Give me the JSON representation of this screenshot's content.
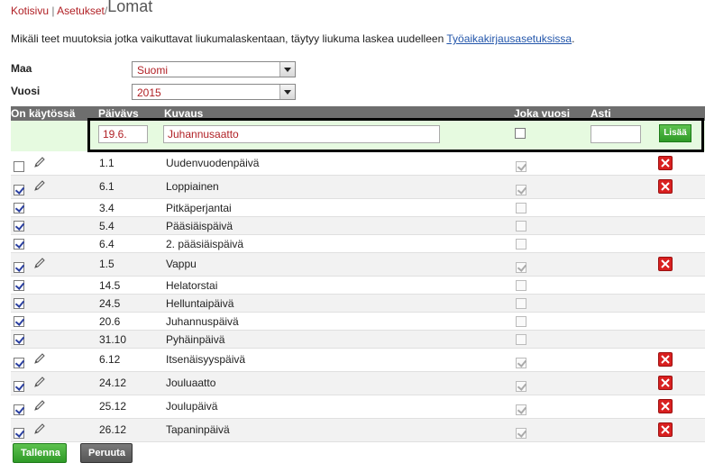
{
  "breadcrumb": {
    "home": "Kotisivu",
    "settings": "Asetukset",
    "current": "Lomat",
    "sep": "|",
    "sep2": "/"
  },
  "notice": {
    "text": "Mikäli teet muutoksia jotka vaikuttavat liukumalaskentaan, täytyy liukuma laskea uudelleen ",
    "link": "Työaikakirjausasetuksissa",
    "end": "."
  },
  "filters": {
    "country_label": "Maa",
    "country_value": "Suomi",
    "year_label": "Vuosi",
    "year_value": "2015"
  },
  "table": {
    "headers": {
      "enabled": "On käytössä",
      "date": "Päivävs",
      "desc": "Kuvaus",
      "yearly": "Joka vuosi",
      "until": "Asti"
    },
    "new_row": {
      "date": "19.6.",
      "desc": "Juhannusaatto",
      "until": "",
      "yearly": false,
      "add_label": "Lisää"
    },
    "rows": [
      {
        "enabled": false,
        "editable": true,
        "date": "1.1",
        "desc": "Uudenvuodenpäivä",
        "yearly": true,
        "deletable": true
      },
      {
        "enabled": true,
        "editable": true,
        "date": "6.1",
        "desc": "Loppiainen",
        "yearly": true,
        "deletable": true
      },
      {
        "enabled": true,
        "editable": false,
        "date": "3.4",
        "desc": "Pitkäperjantai",
        "yearly": false,
        "deletable": false
      },
      {
        "enabled": true,
        "editable": false,
        "date": "5.4",
        "desc": "Pääsiäispäivä",
        "yearly": false,
        "deletable": false
      },
      {
        "enabled": true,
        "editable": false,
        "date": "6.4",
        "desc": "2. pääsiäispäivä",
        "yearly": false,
        "deletable": false
      },
      {
        "enabled": true,
        "editable": true,
        "date": "1.5",
        "desc": "Vappu",
        "yearly": true,
        "deletable": true
      },
      {
        "enabled": true,
        "editable": false,
        "date": "14.5",
        "desc": "Helatorstai",
        "yearly": false,
        "deletable": false
      },
      {
        "enabled": true,
        "editable": false,
        "date": "24.5",
        "desc": "Helluntaipäivä",
        "yearly": false,
        "deletable": false
      },
      {
        "enabled": true,
        "editable": false,
        "date": "20.6",
        "desc": "Juhannuspäivä",
        "yearly": false,
        "deletable": false
      },
      {
        "enabled": true,
        "editable": false,
        "date": "31.10",
        "desc": "Pyhäinpäivä",
        "yearly": false,
        "deletable": false
      },
      {
        "enabled": true,
        "editable": true,
        "date": "6.12",
        "desc": "Itsenäisyyspäivä",
        "yearly": true,
        "deletable": true
      },
      {
        "enabled": true,
        "editable": true,
        "date": "24.12",
        "desc": "Jouluaatto",
        "yearly": true,
        "deletable": true
      },
      {
        "enabled": true,
        "editable": true,
        "date": "25.12",
        "desc": "Joulupäivä",
        "yearly": true,
        "deletable": true
      },
      {
        "enabled": true,
        "editable": true,
        "date": "26.12",
        "desc": "Tapaninpäivä",
        "yearly": true,
        "deletable": true
      }
    ]
  },
  "actions": {
    "save": "Tallenna",
    "cancel": "Peruuta"
  },
  "colors": {
    "accent_red": "#b01f24",
    "button_green": "#2f9a27",
    "header_gray": "#6e6e6e",
    "new_row_bg": "#e6fae0"
  }
}
